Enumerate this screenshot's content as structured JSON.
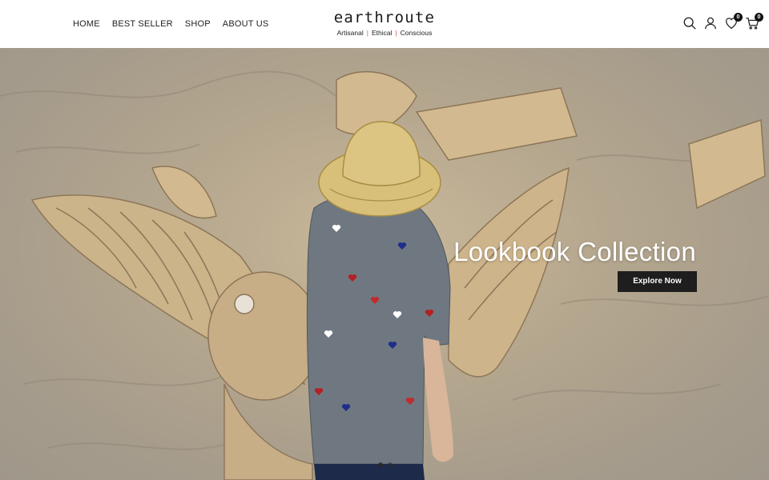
{
  "header": {
    "nav": [
      {
        "label": "HOME"
      },
      {
        "label": "BEST SELLER"
      },
      {
        "label": "SHOP"
      },
      {
        "label": "ABOUT US"
      }
    ],
    "logo": {
      "word": "earthroute",
      "tagline": [
        "Artisanal",
        "Ethical",
        "Conscious"
      ],
      "tagline_separator": "|"
    },
    "icons": {
      "search": "search-icon",
      "account": "user-icon",
      "wishlist": {
        "icon": "heart-icon",
        "count": "0"
      },
      "cart": {
        "icon": "cart-icon",
        "count": "0"
      }
    }
  },
  "hero": {
    "title": "Lookbook Collection",
    "cta_label": "Explore Now",
    "slides": 2,
    "active_slide": 1
  },
  "colors": {
    "accent_separator": "#d9534f",
    "cta_background": "#1e1e1e",
    "header_background": "#ffffff"
  }
}
